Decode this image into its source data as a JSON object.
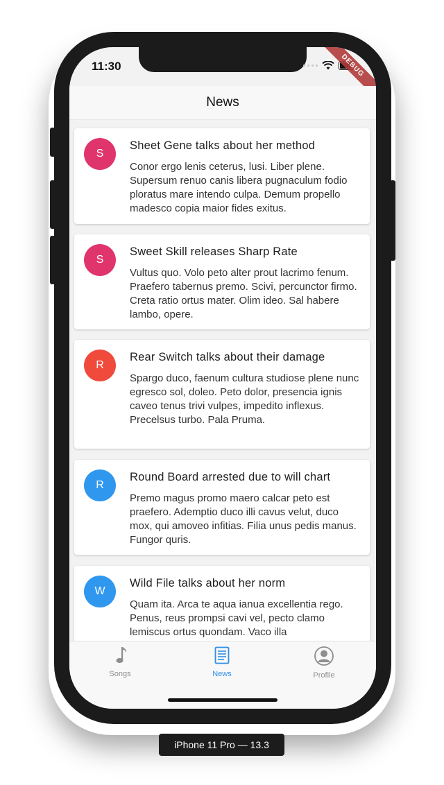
{
  "status_bar": {
    "time": "11:30",
    "debug_banner": "DEBUG"
  },
  "app_bar": {
    "title": "News"
  },
  "articles": [
    {
      "avatar_letter": "S",
      "avatar_color": "#e0356c",
      "title": "Sheet Gene talks about her method",
      "body": "Conor ergo lenis ceterus, lusi. Liber plene. Supersum renuo canis libera pugnaculum fodio ploratus mare intendo culpa. Demum propello madesco copia maior fides exitus."
    },
    {
      "avatar_letter": "S",
      "avatar_color": "#e0356c",
      "title": "Sweet Skill releases Sharp Rate",
      "body": "Vultus quo. Volo peto alter prout lacrimo fenum. Praefero tabernus premo. Scivi, percunctor firmo. Creta ratio ortus mater. Olim ideo. Sal habere lambo, opere."
    },
    {
      "avatar_letter": "R",
      "avatar_color": "#f04a3c",
      "title": "Rear Switch talks about their damage",
      "body": "Spargo duco, faenum cultura studiose plene nunc egresco sol, doleo. Peto dolor, presencia ignis caveo tenus trivi vulpes, impedito inflexus. Precelsus turbo. Pala Pruma."
    },
    {
      "avatar_letter": "R",
      "avatar_color": "#2f97ee",
      "title": "Round Board arrested due to will chart",
      "body": "Premo magus promo maero calcar peto est praefero. Ademptio duco illi cavus velut, duco mox, qui amoveo infitias. Filia unus pedis manus. Fungor quris."
    },
    {
      "avatar_letter": "W",
      "avatar_color": "#2f97ee",
      "title": "Wild File talks about her norm",
      "body": "Quam ita. Arca te aqua ianua excellentia rego. Penus, reus prompsi cavi vel, pecto clamo lemiscus ortus quondam. Vaco illa"
    }
  ],
  "tabs": [
    {
      "label": "Songs",
      "icon": "music-note-icon",
      "active": false
    },
    {
      "label": "News",
      "icon": "news-icon",
      "active": true
    },
    {
      "label": "Profile",
      "icon": "profile-icon",
      "active": false
    }
  ],
  "colors": {
    "active_tab": "#2f8fe8",
    "inactive_tab": "#8e8e8e"
  },
  "device_label": "iPhone 11 Pro — 13.3"
}
